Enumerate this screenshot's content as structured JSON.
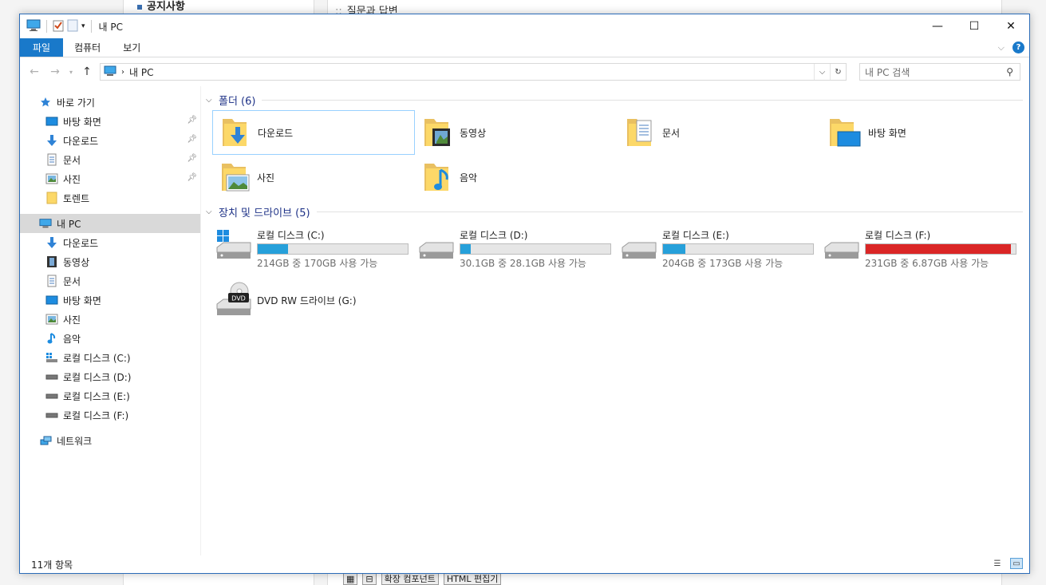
{
  "background": {
    "notice": "공지사항",
    "qna": "질문과 답변",
    "bottom_toolbar": [
      "확장 컴포넌트",
      "HTML 편집기"
    ]
  },
  "window": {
    "title": "내 PC",
    "controls": {
      "minimize": "—",
      "maximize": "☐",
      "close": "✕"
    }
  },
  "ribbon": {
    "tabs": [
      {
        "label": "파일"
      },
      {
        "label": "컴퓨터"
      },
      {
        "label": "보기"
      }
    ],
    "help": "?"
  },
  "navbar": {
    "address": "내 PC",
    "search_placeholder": "내 PC 검색"
  },
  "sidebar": {
    "quick_access": "바로 가기",
    "quick_items": [
      {
        "label": "바탕 화면",
        "icon": "desktop-icon",
        "pinned": true
      },
      {
        "label": "다운로드",
        "icon": "download-icon",
        "pinned": true
      },
      {
        "label": "문서",
        "icon": "document-icon",
        "pinned": true
      },
      {
        "label": "사진",
        "icon": "picture-icon",
        "pinned": true
      },
      {
        "label": "토렌트",
        "icon": "folder-icon",
        "pinned": false
      }
    ],
    "this_pc": "내 PC",
    "pc_items": [
      {
        "label": "다운로드",
        "icon": "download-icon"
      },
      {
        "label": "동영상",
        "icon": "video-icon"
      },
      {
        "label": "문서",
        "icon": "document-icon"
      },
      {
        "label": "바탕 화면",
        "icon": "desktop-icon"
      },
      {
        "label": "사진",
        "icon": "picture-icon"
      },
      {
        "label": "음악",
        "icon": "music-icon"
      },
      {
        "label": "로컬 디스크 (C:)",
        "icon": "windows-drive-icon"
      },
      {
        "label": "로컬 디스크 (D:)",
        "icon": "drive-icon"
      },
      {
        "label": "로컬 디스크 (E:)",
        "icon": "drive-icon"
      },
      {
        "label": "로컬 디스크 (F:)",
        "icon": "drive-icon"
      }
    ],
    "network": "네트워크"
  },
  "content": {
    "folders_header": "폴더 (6)",
    "folders": [
      {
        "label": "다운로드",
        "icon": "download-folder-icon"
      },
      {
        "label": "동영상",
        "icon": "video-folder-icon"
      },
      {
        "label": "문서",
        "icon": "document-folder-icon"
      },
      {
        "label": "바탕 화면",
        "icon": "desktop-folder-icon"
      },
      {
        "label": "사진",
        "icon": "picture-folder-icon"
      },
      {
        "label": "음악",
        "icon": "music-folder-icon"
      }
    ],
    "drives_header": "장치 및 드라이브 (5)",
    "drives": [
      {
        "label": "로컬 디스크 (C:)",
        "free": "214GB 중 170GB 사용 가능",
        "used_fraction": 0.2,
        "critical": false
      },
      {
        "label": "로컬 디스크 (D:)",
        "free": "30.1GB 중 28.1GB 사용 가능",
        "used_fraction": 0.07,
        "critical": false
      },
      {
        "label": "로컬 디스크 (E:)",
        "free": "204GB 중 173GB 사용 가능",
        "used_fraction": 0.15,
        "critical": false
      },
      {
        "label": "로컬 디스크 (F:)",
        "free": "231GB 중 6.87GB 사용 가능",
        "used_fraction": 0.97,
        "critical": true
      }
    ],
    "dvd": {
      "label": "DVD RW 드라이브 (G:)",
      "badge": "DVD"
    }
  },
  "status": {
    "count": "11개 항목"
  }
}
